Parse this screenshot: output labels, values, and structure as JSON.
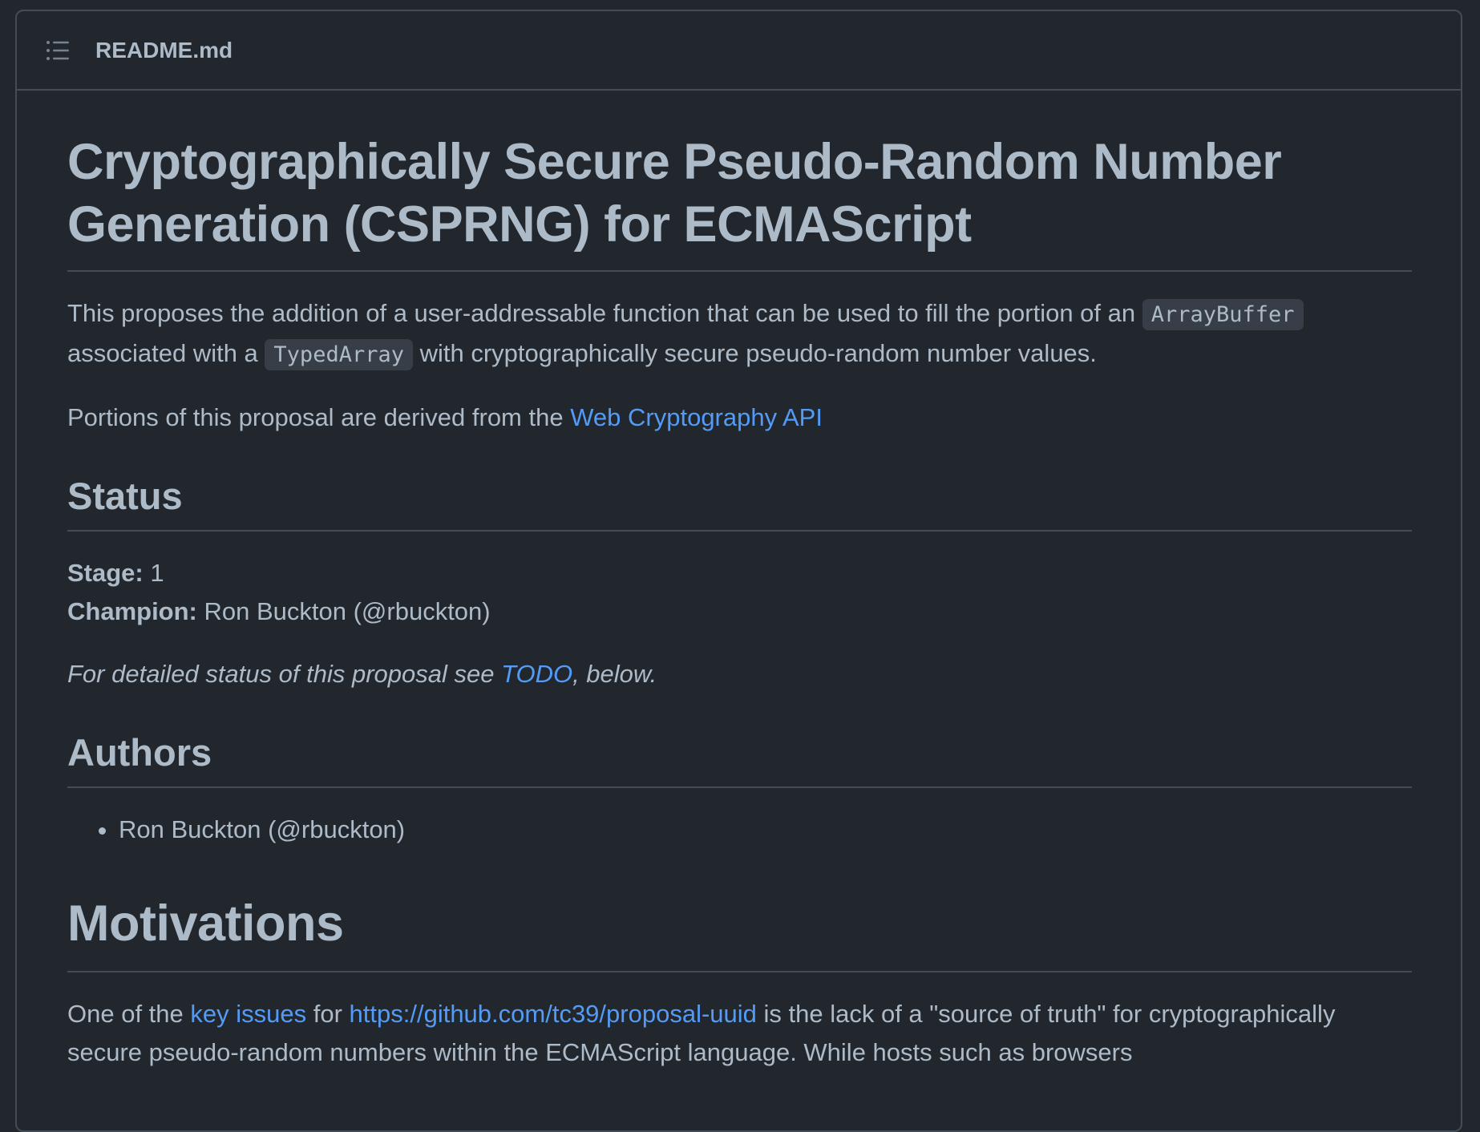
{
  "header": {
    "filename": "README.md",
    "toc_icon": "list-unordered-icon"
  },
  "title": {
    "line1": "Cryptographically Secure Pseudo-Random Number",
    "line2": "Generation (CSPRNG) for ECMAScript"
  },
  "intro": {
    "t1": "This proposes the addition of a user-addressable function that can be used to fill the portion of an ",
    "code1": "ArrayBuffer",
    "t2": " associated with a ",
    "code2": "TypedArray",
    "t3": " with cryptographically secure pseudo-random number values."
  },
  "derived": {
    "text": "Portions of this proposal are derived from the ",
    "link": "Web Cryptography API"
  },
  "status": {
    "heading": "Status",
    "stage_label": "Stage:",
    "stage_value": " 1",
    "champion_label": "Champion:",
    "champion_value": " Ron Buckton (@rbuckton)",
    "detail_text": "For detailed status of this proposal see ",
    "detail_link": "TODO",
    "detail_end": ", below."
  },
  "authors": {
    "heading": "Authors",
    "items": [
      "Ron Buckton (@rbuckton)"
    ]
  },
  "motivations": {
    "heading": "Motivations",
    "t1": "One of the ",
    "link1": "key issues",
    "t2": " for ",
    "link2": "https://github.com/tc39/proposal-uuid",
    "t3": " is the lack of a \"source of truth\" for cryptographically secure pseudo-random numbers within the ECMAScript language. While hosts such as browsers"
  },
  "colors": {
    "background": "#22272e",
    "text": "#adbac7",
    "link": "#539bf5",
    "border": "#444c56",
    "code_bg": "#373e47"
  }
}
